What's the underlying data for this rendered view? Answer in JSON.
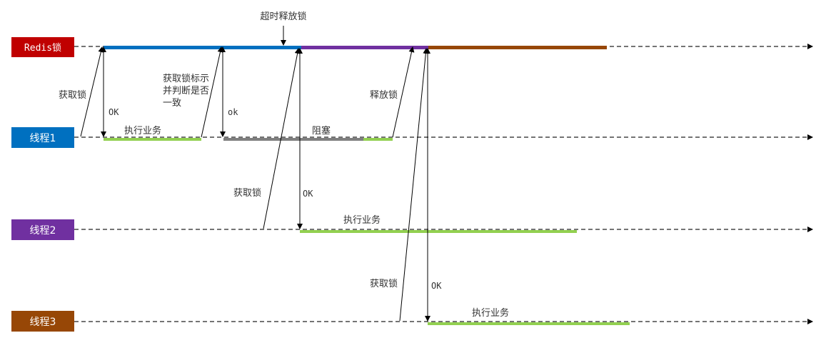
{
  "lanes": {
    "redis": {
      "label": "Redis锁",
      "color": "#c00000"
    },
    "thread1": {
      "label": "线程1",
      "color": "#0070c0"
    },
    "thread2": {
      "label": "线程2",
      "color": "#7030a0"
    },
    "thread3": {
      "label": "线程3",
      "color": "#974706"
    }
  },
  "labels": {
    "timeout_release": "超时释放锁",
    "acquire_lock_t1": "获取锁",
    "ok_t1_first": "OK",
    "execute_t1": "执行业务",
    "check_identity_line1": "获取锁标示",
    "check_identity_line2": "并判断是否",
    "check_identity_line3": "一致",
    "ok_t1_second": "ok",
    "blocked": "阻塞",
    "release_lock": "释放锁",
    "acquire_lock_t2": "获取锁",
    "ok_t2": "OK",
    "execute_t2": "执行业务",
    "acquire_lock_t3": "获取锁",
    "ok_t3": "OK",
    "execute_t3": "执行业务"
  },
  "colors": {
    "lock_holder_t1": "#0070c0",
    "lock_holder_t2": "#7030a0",
    "lock_holder_t3": "#974706",
    "business": "#92d050",
    "blocked": "#7f7f7f",
    "timeline": "#222222",
    "arrow": "#000000"
  }
}
